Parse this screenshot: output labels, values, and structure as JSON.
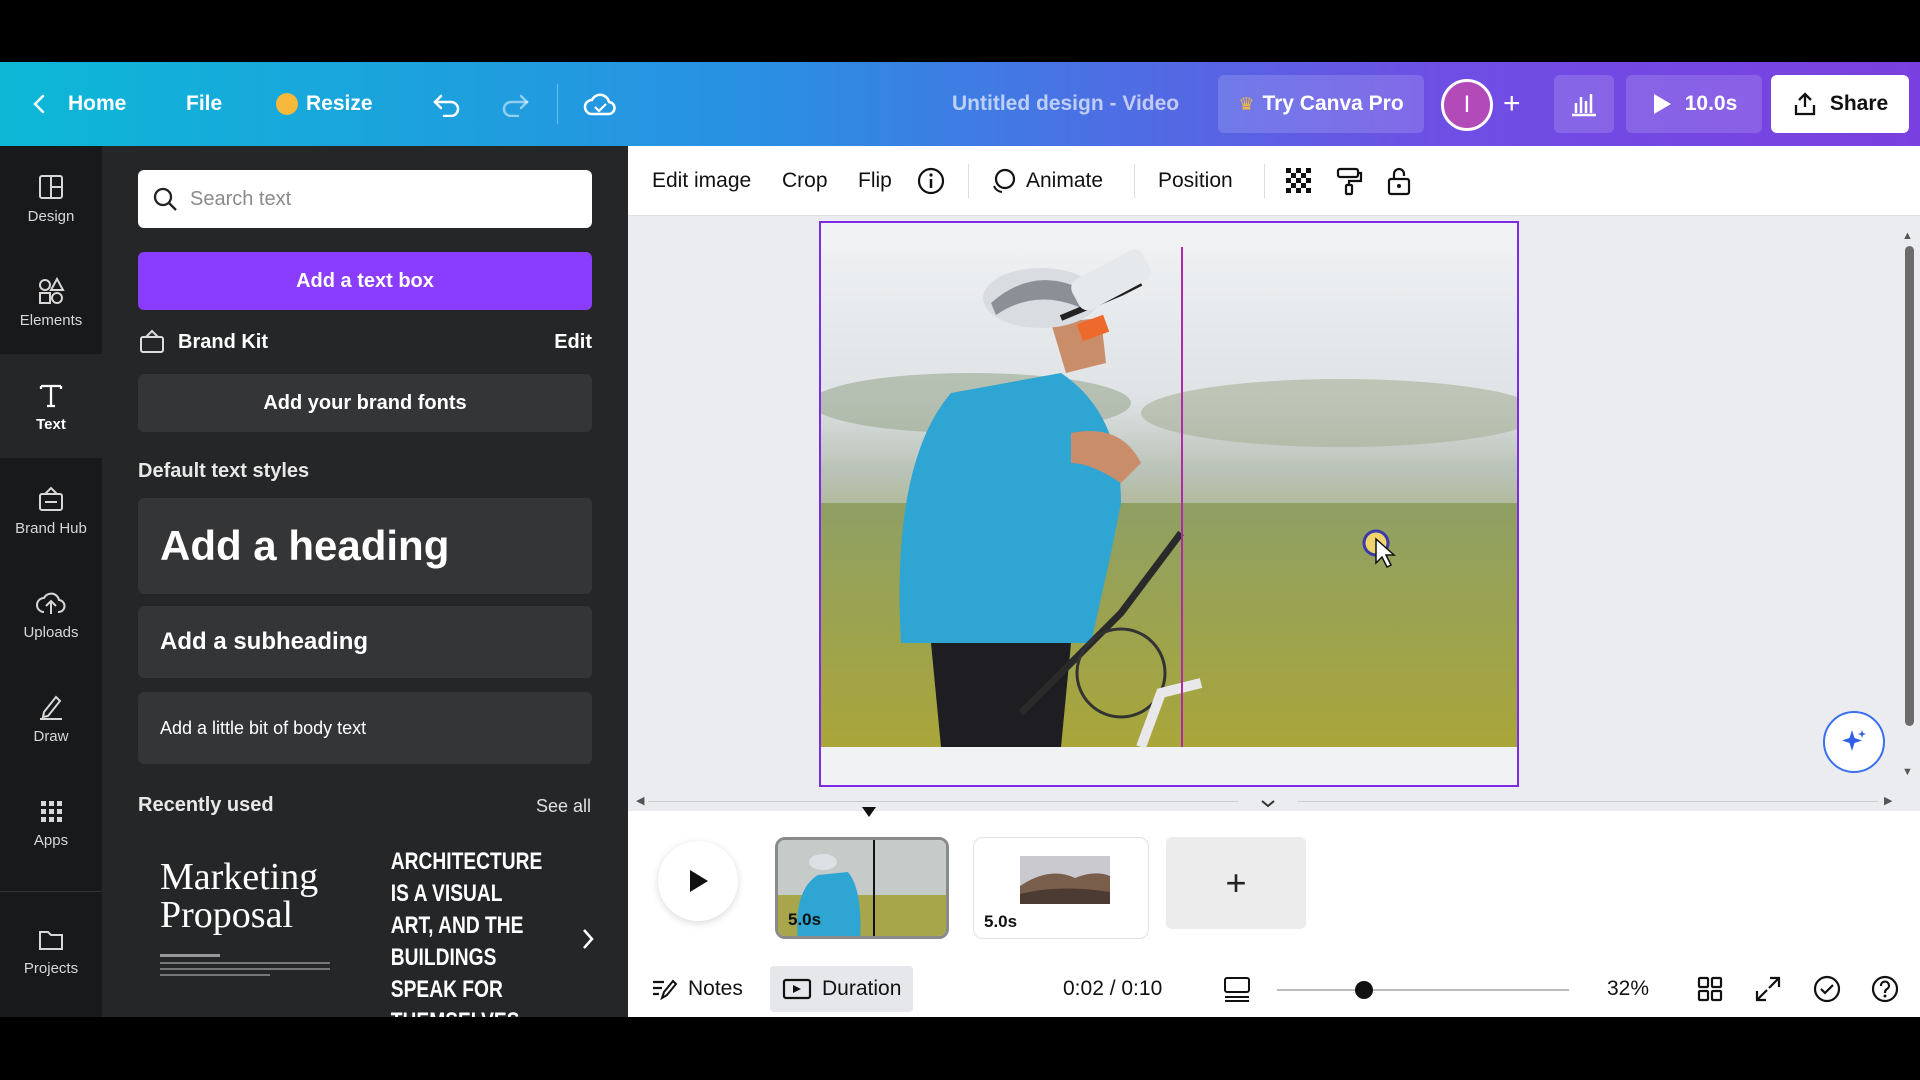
{
  "header": {
    "home": "Home",
    "file": "File",
    "resize": "Resize",
    "title": "Untitled design - Video",
    "try_pro": "Try Canva Pro",
    "avatar_initial": "I",
    "play_duration": "10.0s",
    "share": "Share"
  },
  "rail": {
    "items": [
      {
        "label": "Design",
        "icon": "design-icon"
      },
      {
        "label": "Elements",
        "icon": "elements-icon"
      },
      {
        "label": "Text",
        "icon": "text-icon"
      },
      {
        "label": "Brand Hub",
        "icon": "brand-hub-icon"
      },
      {
        "label": "Uploads",
        "icon": "uploads-icon"
      },
      {
        "label": "Draw",
        "icon": "draw-icon"
      },
      {
        "label": "Apps",
        "icon": "apps-icon"
      },
      {
        "label": "Projects",
        "icon": "projects-icon"
      }
    ]
  },
  "panel": {
    "search_placeholder": "Search text",
    "add_text_box": "Add a text box",
    "brand_kit": "Brand Kit",
    "brand_edit": "Edit",
    "add_brand_fonts": "Add your brand fonts",
    "default_styles": "Default text styles",
    "heading": "Add a heading",
    "subheading": "Add a subheading",
    "body": "Add a little bit of body text",
    "recently_used": "Recently used",
    "see_all": "See all",
    "recent1_title": "Marketing Proposal",
    "recent2_title": "ARCHITECTURE IS A VISUAL ART, AND THE BUILDINGS SPEAK FOR THEMSELVES."
  },
  "toolbar": {
    "edit_image": "Edit image",
    "crop": "Crop",
    "flip": "Flip",
    "animate": "Animate",
    "position": "Position"
  },
  "timeline": {
    "clips": [
      {
        "duration": "5.0s"
      },
      {
        "duration": "5.0s"
      }
    ],
    "add_clip": "+",
    "notes": "Notes",
    "duration": "Duration",
    "time": "0:02 / 0:10",
    "zoom": "32%"
  },
  "colors": {
    "accent": "#8b3dff",
    "frame": "#7d2ae8"
  }
}
